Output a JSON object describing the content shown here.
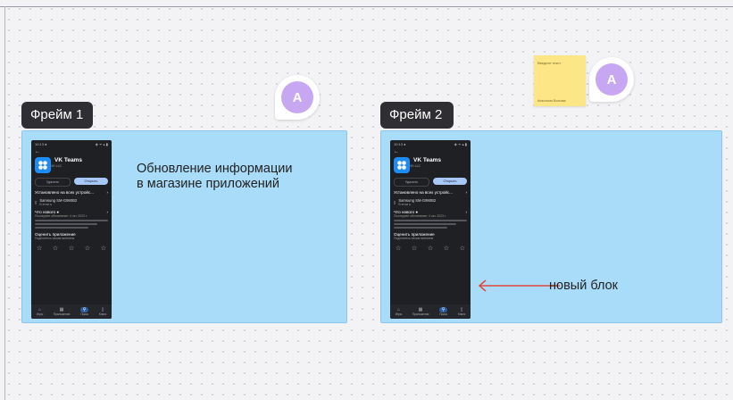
{
  "frames": [
    {
      "label": "Фрейм 1",
      "note": "Обновление информации в магазине приложений",
      "note_line1": "Обновление информации",
      "note_line2": "в магазине приложений"
    },
    {
      "label": "Фрейм 2",
      "annotation": "новый блок"
    }
  ],
  "phone": {
    "time": "10:13 ●",
    "signal": "◈ ᯤ ▴ ▮",
    "back": "←",
    "app_name": "VK Teams",
    "app_sub": "VK LLC",
    "btn_delete": "Удалить",
    "btn_open": "Открыть",
    "installed_on": "Установлено на всех устройс...",
    "device": "Samsung SM-G990B2",
    "device_sub": "В этом ●",
    "whats_new": "Что нового ●",
    "whats_new_sub": "Последнее обновление: 4 окт. 2023 г.",
    "rate": "Оценить приложение",
    "rate_sub": "Поделитесь своим мнением",
    "stars": "☆",
    "nav": [
      "Игры",
      "Приложения",
      "Поиск",
      "Книги"
    ]
  },
  "collaborators": [
    {
      "initial": "A"
    },
    {
      "initial": "A"
    }
  ],
  "sticky": {
    "title": "Введите текст",
    "author": "Анастасия Волкова"
  },
  "colors": {
    "frame_fill": "#a9dcf9",
    "label_bg": "#2f2f33",
    "avatar": "#c8a7f2",
    "arrow": "#e0463e",
    "sticky": "#fde686"
  }
}
